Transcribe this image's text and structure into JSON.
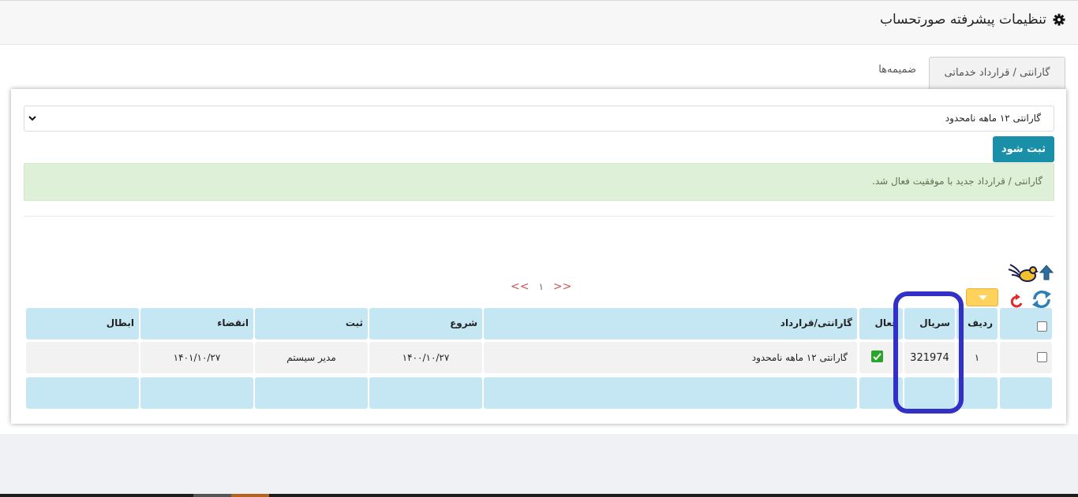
{
  "header": {
    "title": "تنظیمات پیشرفته صورتحساب",
    "icon": "gear-icon"
  },
  "tabs": [
    {
      "label": "گارانتی / قرارداد خدماتی",
      "active": true
    },
    {
      "label": "ضمیمه‌ها",
      "active": false
    }
  ],
  "form": {
    "select_value": "گارانتی ۱۲ ماهه نامحدود",
    "save_label": "ثبت شود"
  },
  "alert": {
    "message": "گارانتی / قرارداد جدید با موفقیت فعال شد."
  },
  "pager": {
    "prev": "<<",
    "current": "۱",
    "next": ">>"
  },
  "table": {
    "headers": {
      "row_num": "ردیف",
      "serial": "سریال",
      "active": "فعال",
      "warranty": "گارانتی/قرارداد",
      "start": "شروع",
      "registered": "ثبت",
      "expiry": "انقضاء",
      "cancel": "ابطال"
    },
    "rows": [
      {
        "row_num": "۱",
        "serial": "321974",
        "active": true,
        "warranty": "گارانتی ۱۲ ماهه نامحدود",
        "start": "۱۴۰۰/۱۰/۲۷",
        "registered": "مدیر سیستم",
        "expiry": "۱۴۰۱/۱۰/۲۷",
        "cancel": ""
      }
    ]
  },
  "colors": {
    "accent": "#1a8fa8",
    "header_cell": "#c5e7f3",
    "highlight": "#3330c8",
    "alert_bg": "#def0d8",
    "check": "#2aa52a"
  }
}
